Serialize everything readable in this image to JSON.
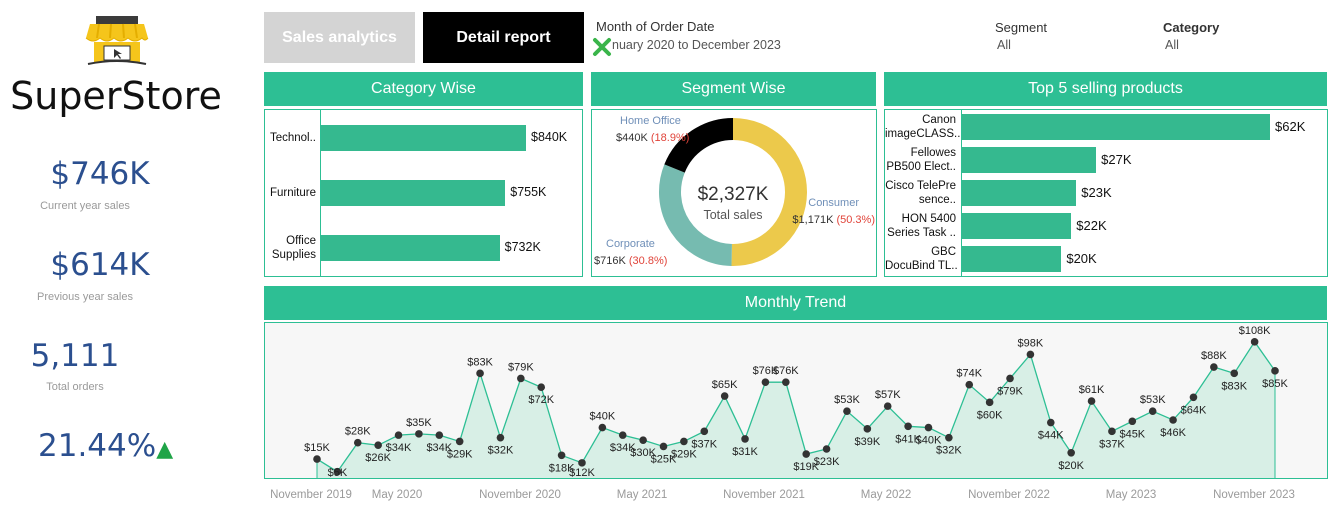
{
  "brand": {
    "name": "SuperStore"
  },
  "kpis": [
    {
      "value": "$746K",
      "label": "Current year sales"
    },
    {
      "value": "$614K",
      "label": "Previous year sales"
    },
    {
      "value": "5,111",
      "label": "Total orders"
    }
  ],
  "growth": {
    "value": "21.44%",
    "arrow": "▲"
  },
  "nav": {
    "sales_analytics": "Sales analytics",
    "detail_report": "Detail report"
  },
  "filters": {
    "date": {
      "label": "Month of Order Date",
      "value": "nuary 2020 to December 2023"
    },
    "segment": {
      "label": "Segment",
      "value": "All"
    },
    "category": {
      "label": "Category",
      "value": "All"
    }
  },
  "colors": {
    "accent": "#2dbf94",
    "bar": "#35b98f",
    "consumer": "#ecc94b",
    "corporate": "#76bbb0",
    "home_office": "#000000",
    "pct": "#e0443a",
    "kpi": "#2b4f8f"
  },
  "panels": {
    "category": {
      "title": "Category Wise"
    },
    "segment": {
      "title": "Segment Wise"
    },
    "products": {
      "title": "Top 5 selling products"
    },
    "trend": {
      "title": "Monthly Trend"
    }
  },
  "chart_data": [
    {
      "type": "bar",
      "title": "Category Wise",
      "categories": [
        "Technol..",
        "Furniture",
        "Office Supplies"
      ],
      "values": [
        840,
        755,
        732
      ],
      "labels": [
        "$840K",
        "$755K",
        "$732K"
      ]
    },
    {
      "type": "pie",
      "title": "Segment Wise",
      "center_value": "$2,327K",
      "center_label": "Total sales",
      "slices": [
        {
          "name": "Consumer",
          "value": 1171,
          "label": "$1,171K",
          "pct": "(50.3%)"
        },
        {
          "name": "Corporate",
          "value": 716,
          "label": "$716K",
          "pct": "(30.8%)"
        },
        {
          "name": "Home Office",
          "value": 440,
          "label": "$440K",
          "pct": "(18.9%)"
        }
      ]
    },
    {
      "type": "bar",
      "title": "Top 5 selling products",
      "categories": [
        "Canon imageCLASS..",
        "Fellowes PB500 Elect..",
        "Cisco TelePre sence..",
        "HON 5400 Series Task ..",
        "GBC DocuBind TL.."
      ],
      "values": [
        62,
        27,
        23,
        22,
        20
      ],
      "labels": [
        "$62K",
        "$27K",
        "$23K",
        "$22K",
        "$20K"
      ]
    },
    {
      "type": "area",
      "title": "Monthly Trend",
      "x_ticks": [
        "November 2019",
        "May 2020",
        "November 2020",
        "May 2021",
        "November 2021",
        "May 2022",
        "November 2022",
        "May 2023",
        "November 2023"
      ],
      "values": [
        15,
        5,
        28,
        26,
        34,
        35,
        34,
        29,
        83,
        32,
        79,
        72,
        18,
        12,
        40,
        34,
        30,
        25,
        29,
        37,
        65,
        31,
        76,
        76,
        19,
        23,
        53,
        39,
        57,
        41,
        40,
        32,
        74,
        60,
        79,
        98,
        44,
        20,
        61,
        37,
        45,
        53,
        46,
        64,
        88,
        83,
        108,
        85
      ],
      "labels": [
        "$15K",
        "$5K",
        "$28K",
        "$26K",
        "$34K",
        "$35K",
        "$34K",
        "$29K",
        "$83K",
        "$32K",
        "$79K",
        "$72K",
        "$18K",
        "$12K",
        "$40K",
        "$34K",
        "$30K",
        "$25K",
        "$29K",
        "$37K",
        "$65K",
        "$31K",
        "$76K",
        "$76K",
        "$19K",
        "$23K",
        "$53K",
        "$39K",
        "$57K",
        "$41K",
        "$40K",
        "$32K",
        "$74K",
        "$60K",
        "$79K",
        "$98K",
        "$44K",
        "$20K",
        "$61K",
        "$37K",
        "$45K",
        "$53K",
        "$46K",
        "$64K",
        "$88K",
        "$83K",
        "$108K",
        "$85K"
      ]
    }
  ]
}
